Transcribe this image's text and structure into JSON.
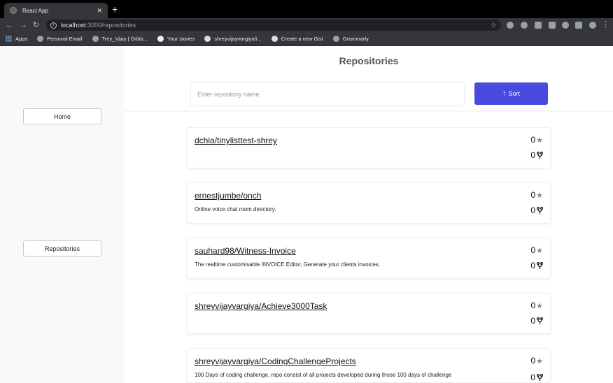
{
  "browser": {
    "tab_title": "React App",
    "url_host": "localhost",
    "url_path": ":3000/repositories",
    "bookmarks": [
      {
        "label": "Apps"
      },
      {
        "label": "Personal Email"
      },
      {
        "label": "Trey_Vijay | Dribb..."
      },
      {
        "label": "Your stories"
      },
      {
        "label": "shreyvijayvargiya/i..."
      },
      {
        "label": "Create a new Gist"
      },
      {
        "label": "Grammarly"
      }
    ]
  },
  "sidebar": {
    "items": [
      {
        "label": "Home"
      },
      {
        "label": "Repositories"
      }
    ]
  },
  "main": {
    "title": "Repositories",
    "search_placeholder": "Enter repository name",
    "sort_label": "Sort",
    "repos": [
      {
        "name": "dchia/tinylisttest-shrey",
        "description": "",
        "stars": "0",
        "forks": "0"
      },
      {
        "name": "ernestjumbe/onch",
        "description": "Online voice chat room directory.",
        "stars": "0",
        "forks": "0"
      },
      {
        "name": "sauhard98/Witness-Invoice",
        "description": "The realtime customisable INVOICE Editor, Generate your clients invoices.",
        "stars": "0",
        "forks": "0"
      },
      {
        "name": "shreyvijayvargiya/Achieve3000Task",
        "description": "",
        "stars": "0",
        "forks": "0"
      },
      {
        "name": "shreyvijayvargiya/CodingChallengeProjects",
        "description": "100 Days of coding challenge, repo consist of all projects developed during those 100 days of challenge",
        "stars": "0",
        "forks": "0"
      }
    ]
  },
  "colors": {
    "accent": "#4a49e0",
    "sidebar_bg": "#f8f9fb"
  }
}
